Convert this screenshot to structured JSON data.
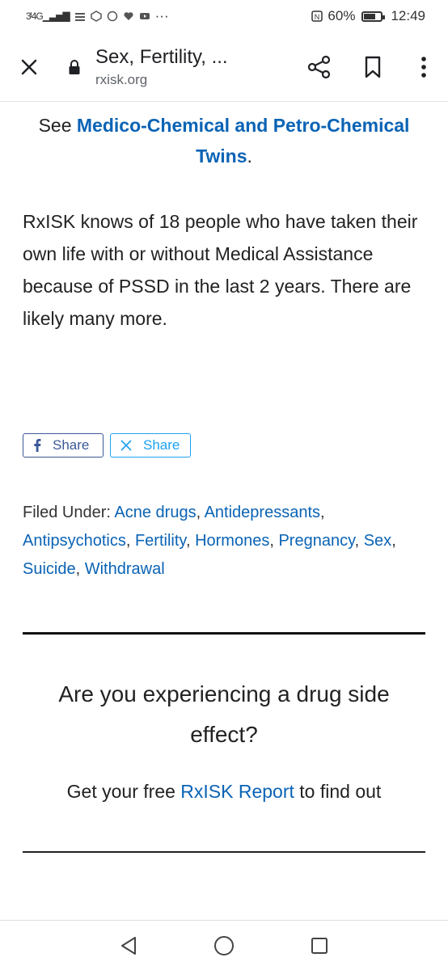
{
  "status": {
    "network": "4G",
    "battery_text": "60%",
    "battery_level": 0.6,
    "time": "12:49",
    "nfc_label": "N"
  },
  "browser": {
    "title": "Sex, Fertility, ...",
    "url": "rxisk.org"
  },
  "article": {
    "see_prefix": "See ",
    "see_link": "Medico-Chemical and Petro-Chemical Twins",
    "see_suffix": ".",
    "paragraph": "RxISK knows of 18 people who have taken their own life with or without Medical Assistance because of PSSD in the last 2 years.  There are likely many more."
  },
  "share": {
    "facebook_label": "Share",
    "x_label": "Share"
  },
  "filed": {
    "label": "Filed Under: ",
    "categories": [
      "Acne drugs",
      "Antidepressants",
      "Antipsychotics",
      "Fertility",
      "Hormones",
      "Pregnancy",
      "Sex",
      "Suicide",
      "Withdrawal"
    ]
  },
  "cta": {
    "title": "Are you experiencing a drug side effect?",
    "sub_prefix": "Get your free ",
    "sub_link": "RxISK Report",
    "sub_suffix": " to find out"
  },
  "colors": {
    "link": "#0a63b5",
    "facebook": "#3b5998",
    "x": "#1da1f2"
  }
}
